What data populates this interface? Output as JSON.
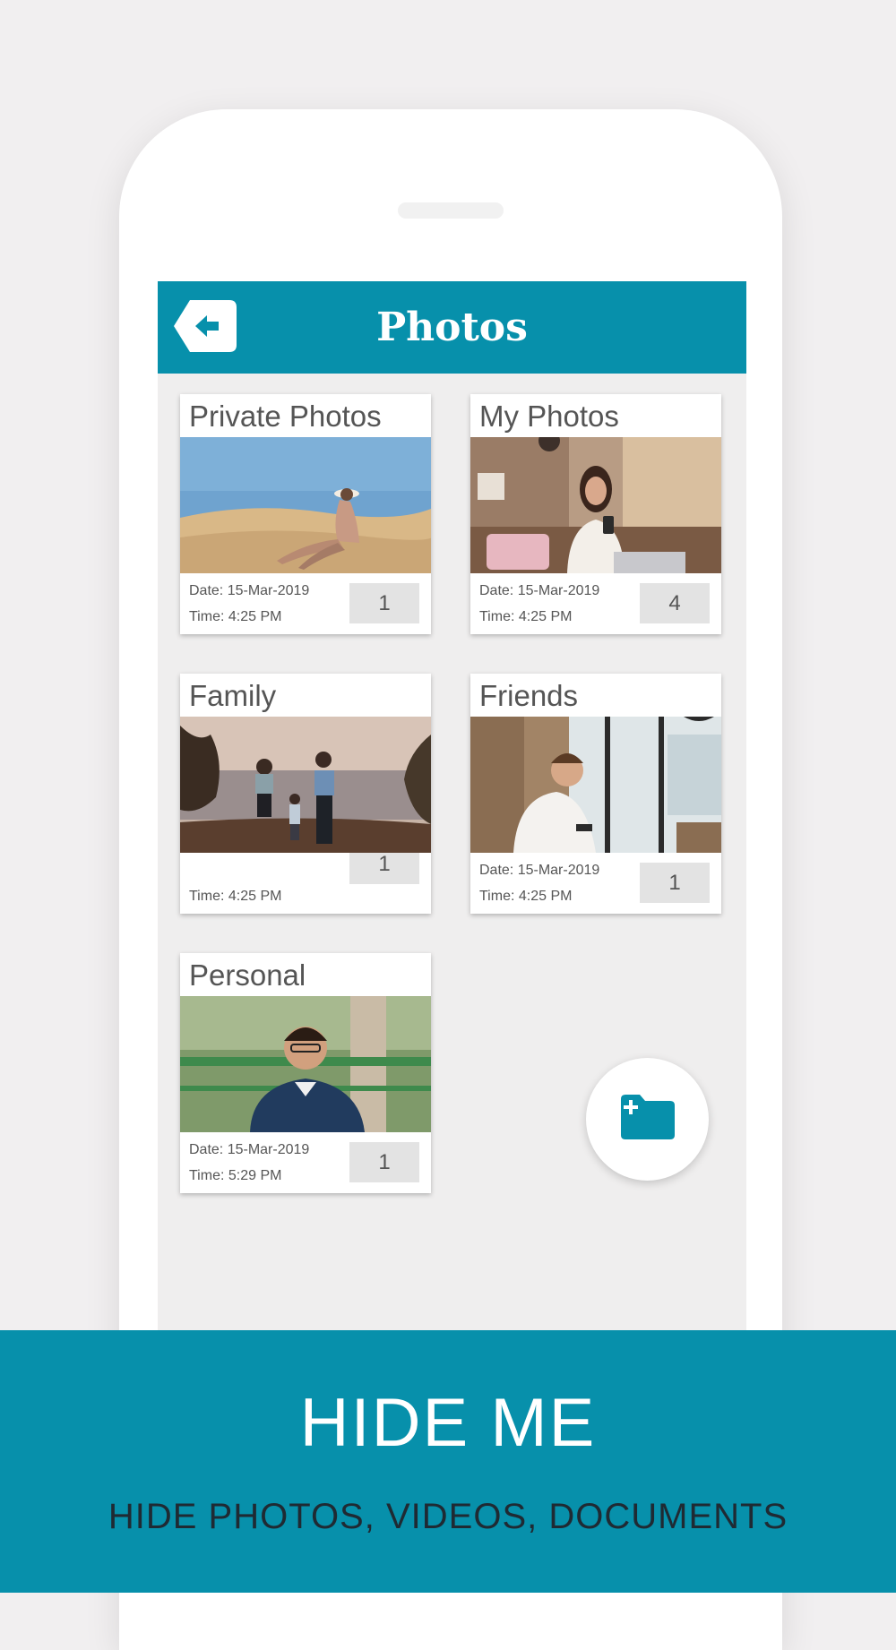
{
  "app_bar": {
    "title": "Photos",
    "back_icon": "back-arrow-icon",
    "color": "#0790ab"
  },
  "albums": [
    {
      "name": "Private Photos",
      "date": "Date: 15-Mar-2019",
      "time": "Time: 4:25 PM",
      "count": "1",
      "image": "woman-sitting-on-sand-dune-photo"
    },
    {
      "name": "My Photos",
      "date": "Date: 15-Mar-2019",
      "time": "Time: 4:25 PM",
      "count": "4",
      "image": "woman-with-phone-in-cafe-photo"
    },
    {
      "name": "Family",
      "date": "",
      "time": "Time: 4:25 PM",
      "count": "1",
      "image": "family-at-sunset-lake-photo"
    },
    {
      "name": "Friends",
      "date": "Date: 15-Mar-2019",
      "time": "Time: 4:25 PM",
      "count": "1",
      "image": "man-with-phone-by-window-photo"
    },
    {
      "name": "Personal",
      "date": "Date: 15-Mar-2019",
      "time": "Time: 5:29 PM",
      "count": "1",
      "image": "man-in-polo-shirt-outdoors-photo"
    }
  ],
  "fab": {
    "icon": "add-folder-icon"
  },
  "banner": {
    "title": "HIDE ME",
    "subtitle": "HIDE PHOTOS, VIDEOS, DOCUMENTS"
  }
}
